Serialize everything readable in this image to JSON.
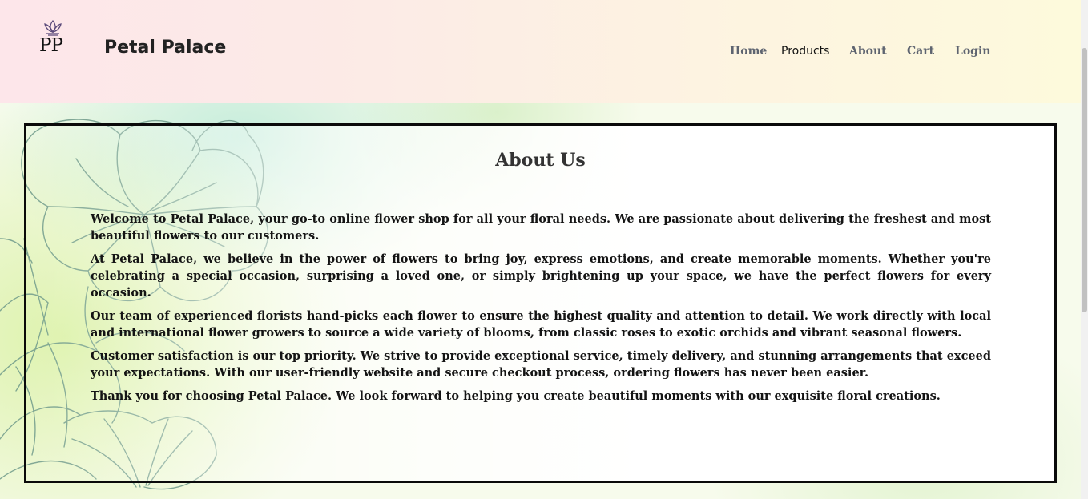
{
  "header": {
    "logo_text": "PP",
    "brand": "Petal Palace",
    "nav": [
      {
        "label": "Home",
        "active": false
      },
      {
        "label": "Products",
        "active": true
      },
      {
        "label": "About",
        "active": false
      },
      {
        "label": "Cart",
        "active": false
      },
      {
        "label": "Login",
        "active": false
      }
    ]
  },
  "about": {
    "title": "About Us",
    "paragraphs": [
      "Welcome to Petal Palace, your go-to online flower shop for all your floral needs. We are passionate about delivering the freshest and most beautiful flowers to our customers.",
      "At Petal Palace, we believe in the power of flowers to bring joy, express emotions, and create memorable moments. Whether you're celebrating a special occasion, surprising a loved one, or simply brightening up your space, we have the perfect flowers for every occasion.",
      "Our team of experienced florists hand-picks each flower to ensure the highest quality and attention to detail. We work directly with local and international flower growers to source a wide variety of blooms, from classic roses to exotic orchids and vibrant seasonal flowers.",
      "Customer satisfaction is our top priority. We strive to provide exceptional service, timely delivery, and stunning arrangements that exceed your expectations. With our user-friendly website and secure checkout process, ordering flowers has never been easier.",
      "Thank you for choosing Petal Palace. We look forward to helping you create beautiful moments with our exquisite floral creations."
    ]
  },
  "icons": {
    "logo_crown": "lotus-crown-icon"
  },
  "colors": {
    "panel_border": "#0a0a0a",
    "flower_line": "#6f9a8a",
    "logo_accent": "#5b4a7a"
  }
}
